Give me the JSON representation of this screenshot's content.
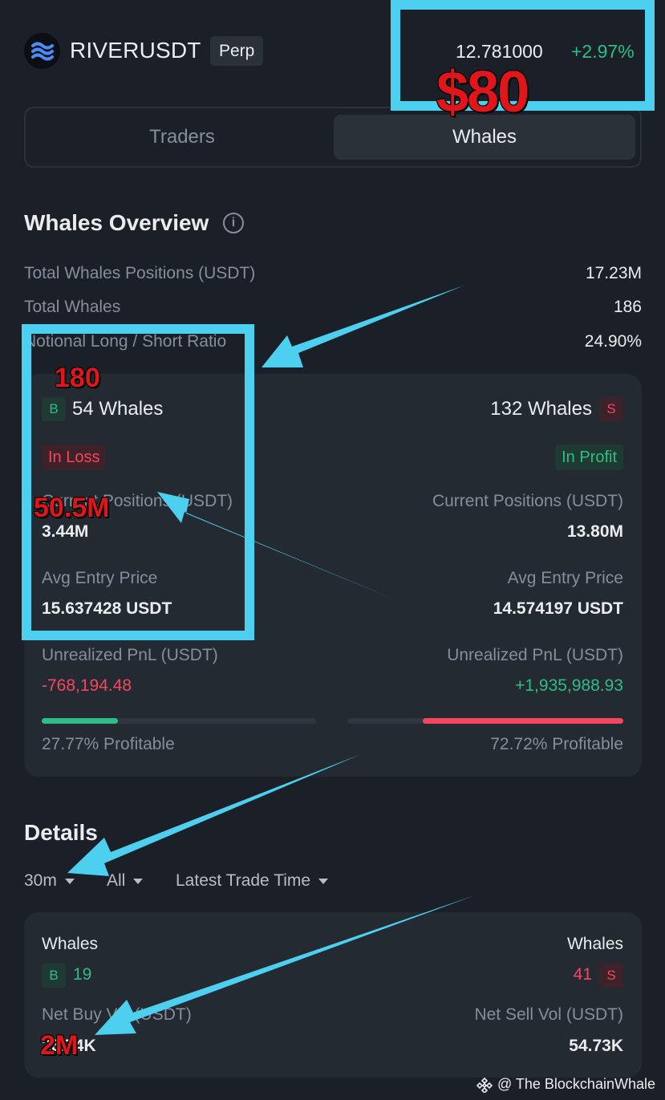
{
  "header": {
    "symbol": "RIVERUSDT",
    "contract_type": "Perp",
    "price": "12.781000",
    "change": "+2.97%"
  },
  "tabs": [
    {
      "label": "Traders",
      "active": false
    },
    {
      "label": "Whales",
      "active": true
    }
  ],
  "overview": {
    "title": "Whales Overview",
    "rows": [
      {
        "label": "Total Whales Positions (USDT)",
        "value": "17.23M"
      },
      {
        "label": "Total Whales",
        "value": "186"
      },
      {
        "label": "Notional Long / Short Ratio",
        "value": "24.90%"
      }
    ]
  },
  "long_side": {
    "badge": "B",
    "whales": "54 Whales",
    "status": "In Loss",
    "positions_label": "Current Positions (USDT)",
    "positions_value": "3.44M",
    "entry_label": "Avg Entry Price",
    "entry_value": "15.637428 USDT",
    "pnl_label": "Unrealized PnL (USDT)",
    "pnl_value": "-768,194.48",
    "profitable": "27.77% Profitable",
    "profitable_ratio": 0.2777
  },
  "short_side": {
    "badge": "S",
    "whales": "132 Whales",
    "status": "In Profit",
    "positions_label": "Current Positions (USDT)",
    "positions_value": "13.80M",
    "entry_label": "Avg Entry Price",
    "entry_value": "14.574197 USDT",
    "pnl_label": "Unrealized PnL (USDT)",
    "pnl_value": "+1,935,988.93",
    "profitable": "72.72% Profitable",
    "profitable_ratio": 0.7272
  },
  "details": {
    "title": "Details",
    "filters": [
      "30m",
      "All",
      "Latest Trade Time"
    ],
    "buy": {
      "label": "Whales",
      "badge": "B",
      "count": "19",
      "vol_label": "Net Buy Vol (USDT)",
      "vol_value": "26.74K"
    },
    "sell": {
      "label": "Whales",
      "badge": "S",
      "count": "41",
      "vol_label": "Net Sell Vol (USDT)",
      "vol_value": "54.73K"
    }
  },
  "annotations": {
    "price_note": "$80",
    "whales_note": "180",
    "position_note": "50.5M",
    "volume_note": "2M"
  },
  "watermark": "@ The BlockchainWhale",
  "colors": {
    "background": "#1b2028",
    "card": "#242a32",
    "green": "#2ebd85",
    "red": "#f6465d",
    "annotation_blue": "#4dd0f0",
    "annotation_red": "#e0161a"
  }
}
